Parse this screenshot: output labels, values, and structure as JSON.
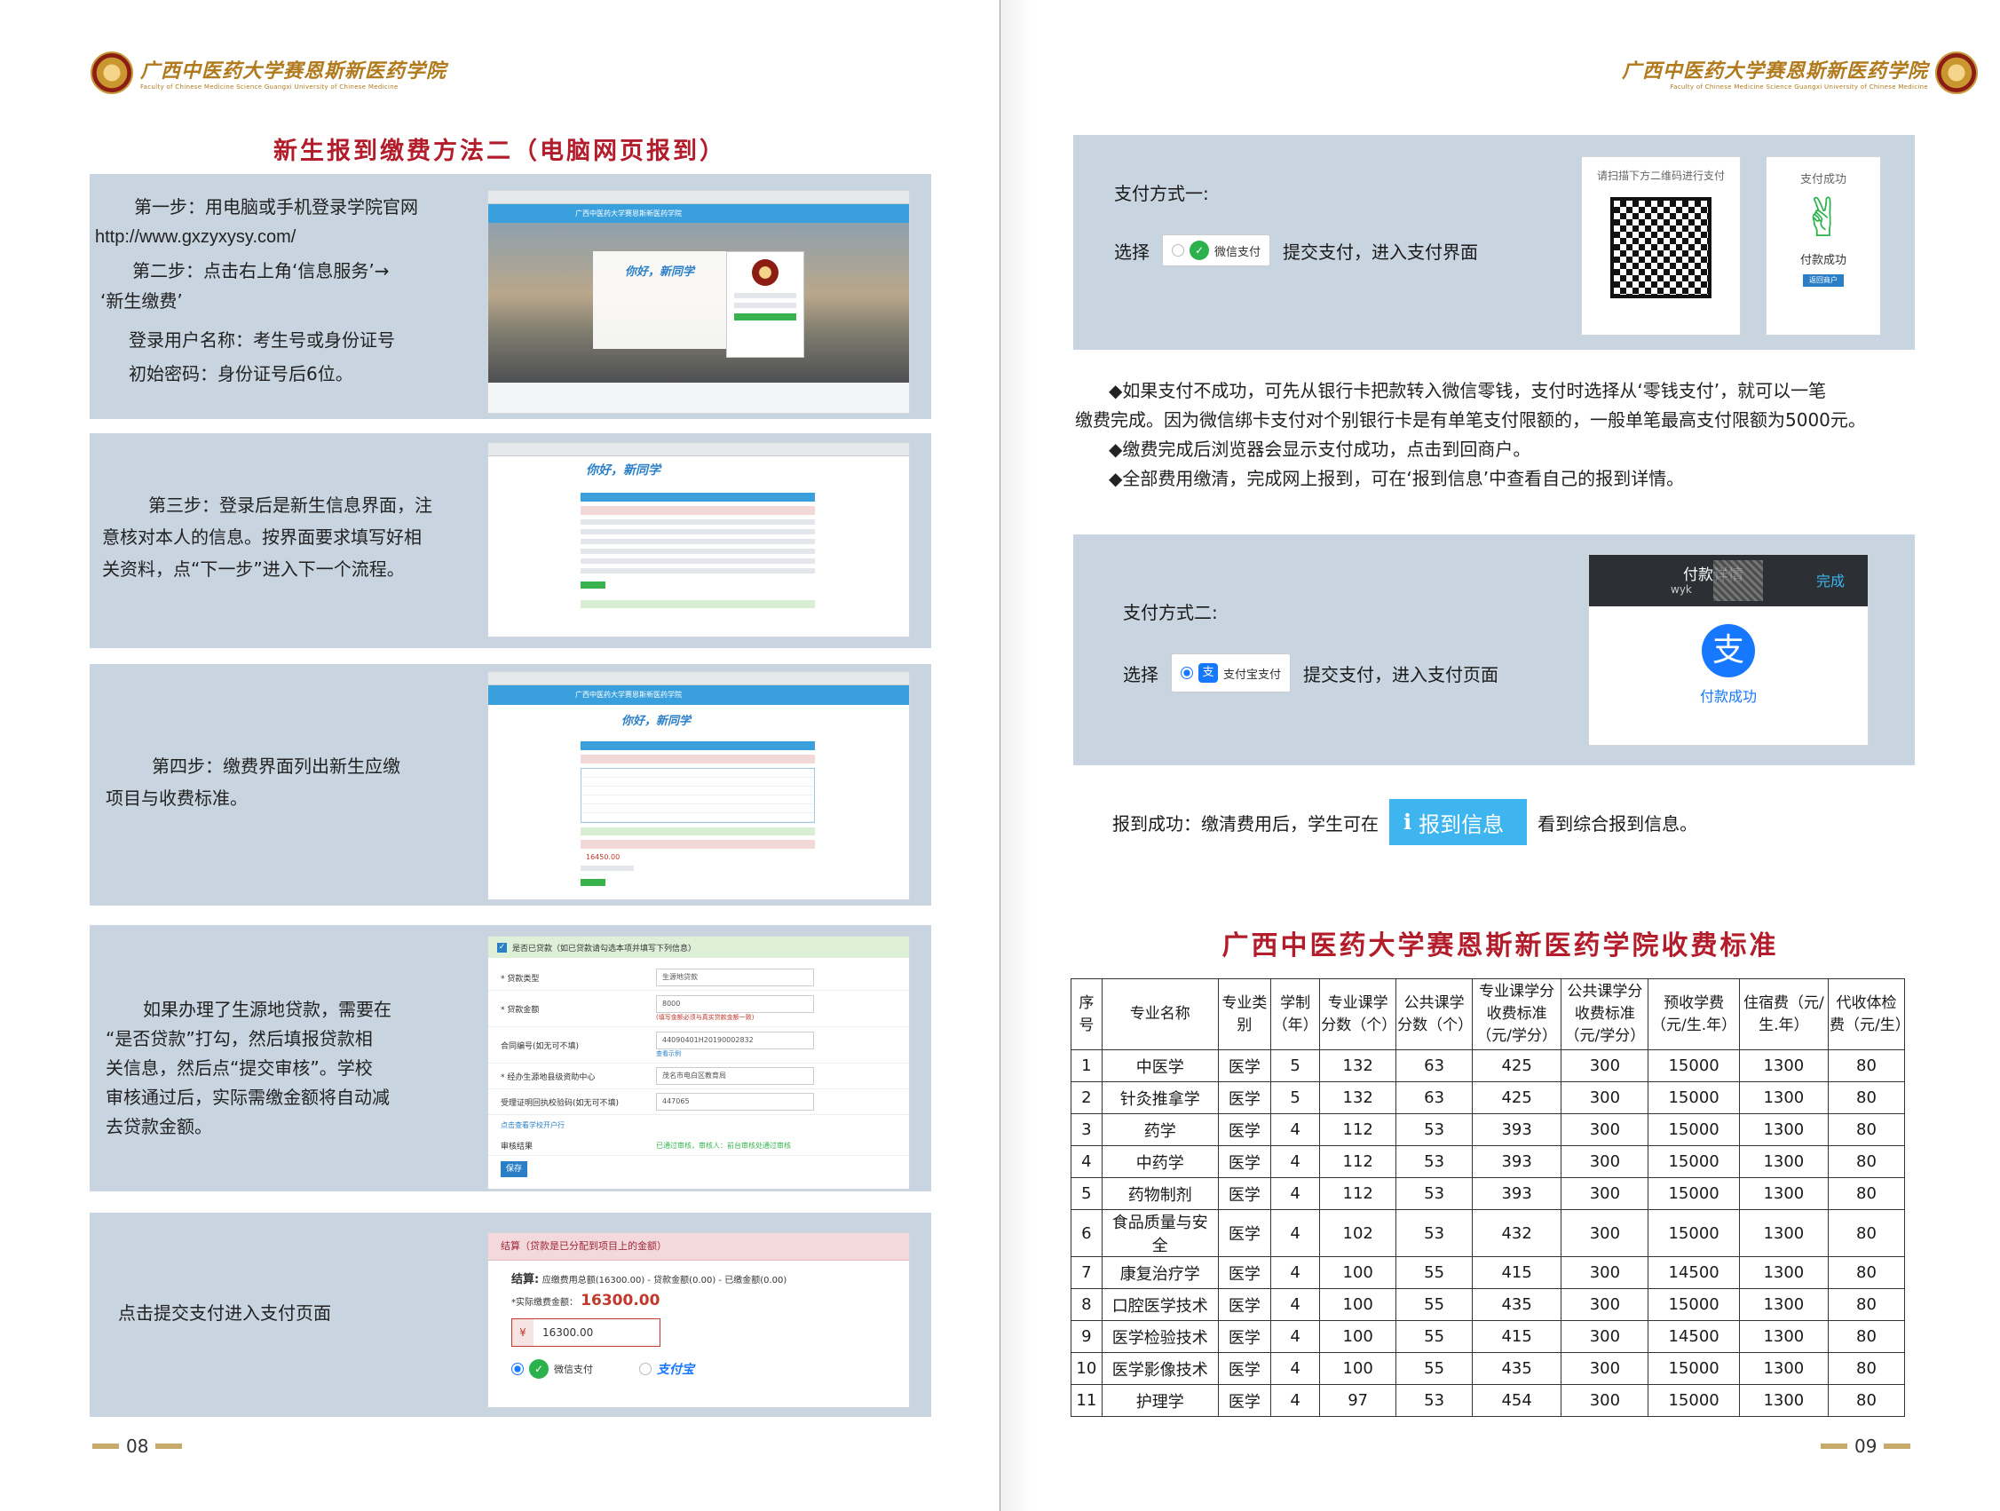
{
  "colors": {
    "accent_red": "#b31d2b",
    "panel_bg": "#c8d4df",
    "gold": "#b07a1d",
    "info_blue": "#3fb5ef"
  },
  "header": {
    "school_cn": "广西中医药大学赛恩斯新医药学院",
    "school_en": "Faculty of Chinese Medicine Science Guangxi University of Chinese Medicine"
  },
  "left": {
    "title": "新生报到缴费方法二（电脑网页报到）",
    "step1": {
      "line1": "第一步：用电脑或手机登录学院官网",
      "url": "http://www.gxzyxysy.com/",
      "line2": "第二步：点击右上角‘信息服务’→",
      "line3": "‘新生缴费’",
      "line4": "登录用户名称：考生号或身份证号",
      "line5": "初始密码：身份证号后6位。"
    },
    "step3": {
      "line1": "第三步：登录后是新生信息界面，注",
      "line2": "意核对本人的信息。按界面要求填写好相",
      "line3": "关资料，点“下一步”进入下一个流程。"
    },
    "step4": {
      "line1": "第四步：缴费界面列出新生应缴",
      "line2": "项目与收费标准。"
    },
    "loan": {
      "line1": "如果办理了生源地贷款，需要在",
      "line2": "“是否贷款”打勾，然后填报贷款相",
      "line3": "关信息，然后点“提交审核”。学校",
      "line4": "审核通过后，实际需缴金额将自动减",
      "line5": "去贷款金额。"
    },
    "submit_text": "点击提交支付进入支付页面",
    "shot1": {
      "site_title": "广西中医药大学赛恩斯新医药学院",
      "welcome": "你好，新同学"
    },
    "shot2": {
      "welcome": "你好，新同学"
    },
    "shot3": {
      "site_title": "广西中医药大学赛恩斯新医药学院",
      "welcome": "你好，新同学",
      "total": "16450.00"
    },
    "loan_form": {
      "header": "是否已贷款（如已贷款请勾选本项并填写下列信息）",
      "rows": [
        {
          "label": "* 贷款类型",
          "value": "生源地贷款"
        },
        {
          "label": "* 贷款金额",
          "value": "8000"
        },
        {
          "label": "合同编号(如无可不填)",
          "value": "44090401H20190002832"
        },
        {
          "label": "* 经办生源地县级资助中心",
          "value": "茂名市电白区教育局"
        },
        {
          "label": "受理证明回执校验码(如无可不填)",
          "value": "447065"
        }
      ],
      "warn": "(填写金额必须与真实贷款金额一致)",
      "link1": "查看示例",
      "link2": "点击查看学校开户行",
      "audit_label": "审核结果",
      "audit_value": "已通过审核，审核人：前台审核处通过审核",
      "save": "保存"
    },
    "payform": {
      "header": "结算（贷款是已分配到项目上的金额）",
      "summary_label": "结算:",
      "summary": "应缴费用总额(16300.00) - 贷款金额(0.00) - 已缴金额(0.00)",
      "actual_label": "*实际缴费金额：",
      "actual": "16300.00",
      "currency": "¥",
      "input_value": "16300.00",
      "wechat": "微信支付",
      "alipay": "支付宝"
    },
    "page_number": "08"
  },
  "right": {
    "pay1": {
      "title": "支付方式一:",
      "choose": "选择",
      "badge": "微信支付",
      "after": "提交支付，进入支付界面",
      "qr_caption": "请扫描下方二维码进行支付",
      "success_caption": "支付成功",
      "success_text": "付款成功",
      "back_btn": "返回商户"
    },
    "notes": [
      "◆如果支付不成功，可先从银行卡把款转入微信零钱，支付时选择从‘零钱支付’，就可以一笔",
      "缴费完成。因为微信绑卡支付对个别银行卡是有单笔支付限额的，一般单笔最高支付限额为5000元。",
      "◆缴费完成后浏览器会显示支付成功，点击到回商户。",
      "◆全部费用缴清，完成网上报到，可在‘报到信息’中查看自己的报到详情。"
    ],
    "pay2": {
      "title": "支付方式二:",
      "choose": "选择",
      "badge": "支付宝支付",
      "after": "提交支付，进入支付页面",
      "phone_title": "付款详情",
      "phone_done": "完成",
      "phone_sub": "wyk",
      "phone_success": "付款成功"
    },
    "report": {
      "before": "报到成功：缴清费用后，学生可在",
      "button": "报到信息",
      "after": "看到综合报到信息。"
    },
    "table_title": "广西中医药大学赛恩斯新医药学院收费标准",
    "table": {
      "headers": [
        "序号",
        "专业名称",
        "专业类别",
        "学制（年）",
        "专业课学分数（个）",
        "公共课学分数（个）",
        "专业课学分收费标准（元/学分）",
        "公共课学分收费标准（元/学分）",
        "预收学费（元/生.年）",
        "住宿费（元/生.年）",
        "代收体检费（元/生）"
      ],
      "rows": [
        [
          "1",
          "中医学",
          "医学",
          "5",
          "132",
          "63",
          "425",
          "300",
          "15000",
          "1300",
          "80"
        ],
        [
          "2",
          "针灸推拿学",
          "医学",
          "5",
          "132",
          "63",
          "425",
          "300",
          "15000",
          "1300",
          "80"
        ],
        [
          "3",
          "药学",
          "医学",
          "4",
          "112",
          "53",
          "393",
          "300",
          "15000",
          "1300",
          "80"
        ],
        [
          "4",
          "中药学",
          "医学",
          "4",
          "112",
          "53",
          "393",
          "300",
          "15000",
          "1300",
          "80"
        ],
        [
          "5",
          "药物制剂",
          "医学",
          "4",
          "112",
          "53",
          "393",
          "300",
          "15000",
          "1300",
          "80"
        ],
        [
          "6",
          "食品质量与安全",
          "医学",
          "4",
          "102",
          "53",
          "432",
          "300",
          "15000",
          "1300",
          "80"
        ],
        [
          "7",
          "康复治疗学",
          "医学",
          "4",
          "100",
          "55",
          "415",
          "300",
          "14500",
          "1300",
          "80"
        ],
        [
          "8",
          "口腔医学技术",
          "医学",
          "4",
          "100",
          "55",
          "435",
          "300",
          "15000",
          "1300",
          "80"
        ],
        [
          "9",
          "医学检验技术",
          "医学",
          "4",
          "100",
          "55",
          "415",
          "300",
          "14500",
          "1300",
          "80"
        ],
        [
          "10",
          "医学影像技术",
          "医学",
          "4",
          "100",
          "55",
          "435",
          "300",
          "15000",
          "1300",
          "80"
        ],
        [
          "11",
          "护理学",
          "医学",
          "4",
          "97",
          "53",
          "454",
          "300",
          "15000",
          "1300",
          "80"
        ]
      ]
    },
    "page_number": "09"
  }
}
